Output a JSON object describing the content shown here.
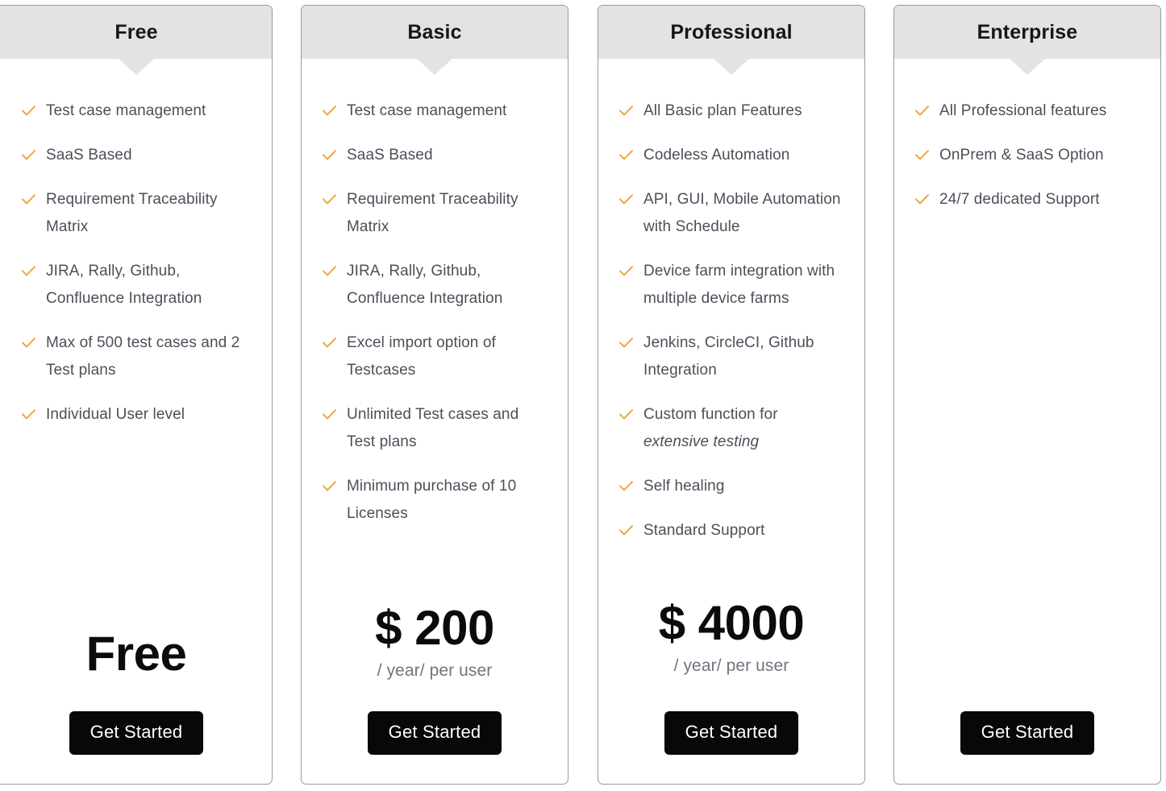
{
  "check_color": "#eda33b",
  "header_bg": "#e3e3e3",
  "button_bg": "#080808",
  "cta_label": "Get Started",
  "plans": [
    {
      "name": "Free",
      "features": [
        "Test case management",
        "SaaS Based",
        "Requirement Traceability Matrix",
        "JIRA, Rally, Github, Confluence Integration",
        "Max of 500 test cases and 2 Test plans",
        "Individual User level"
      ],
      "price": "Free",
      "period": "",
      "cta": "Get Started"
    },
    {
      "name": "Basic",
      "features": [
        "Test case management",
        "SaaS Based",
        "Requirement Traceability Matrix",
        "JIRA, Rally, Github, Confluence Integration",
        "Excel import option of Testcases",
        "Unlimited Test cases and Test plans",
        "Minimum purchase of 10 Licenses"
      ],
      "price": "$ 200",
      "period": "/ year/ per user",
      "cta": "Get Started"
    },
    {
      "name": "Professional",
      "features": [
        "All Basic plan Features",
        "Codeless Automation",
        "API, GUI, Mobile Automation with Schedule",
        "Device farm integration with multiple device farms",
        "Jenkins, CircleCI, Github Integration",
        "Custom function for extensive testing",
        "Self healing",
        "Standard Support"
      ],
      "price": "$ 4000",
      "period": "/ year/ per user",
      "cta": "Get Started"
    },
    {
      "name": "Enterprise",
      "features": [
        "All Professional features",
        "OnPrem & SaaS Option",
        "24/7 dedicated Support"
      ],
      "price": "",
      "period": "",
      "cta": "Get Started"
    }
  ]
}
